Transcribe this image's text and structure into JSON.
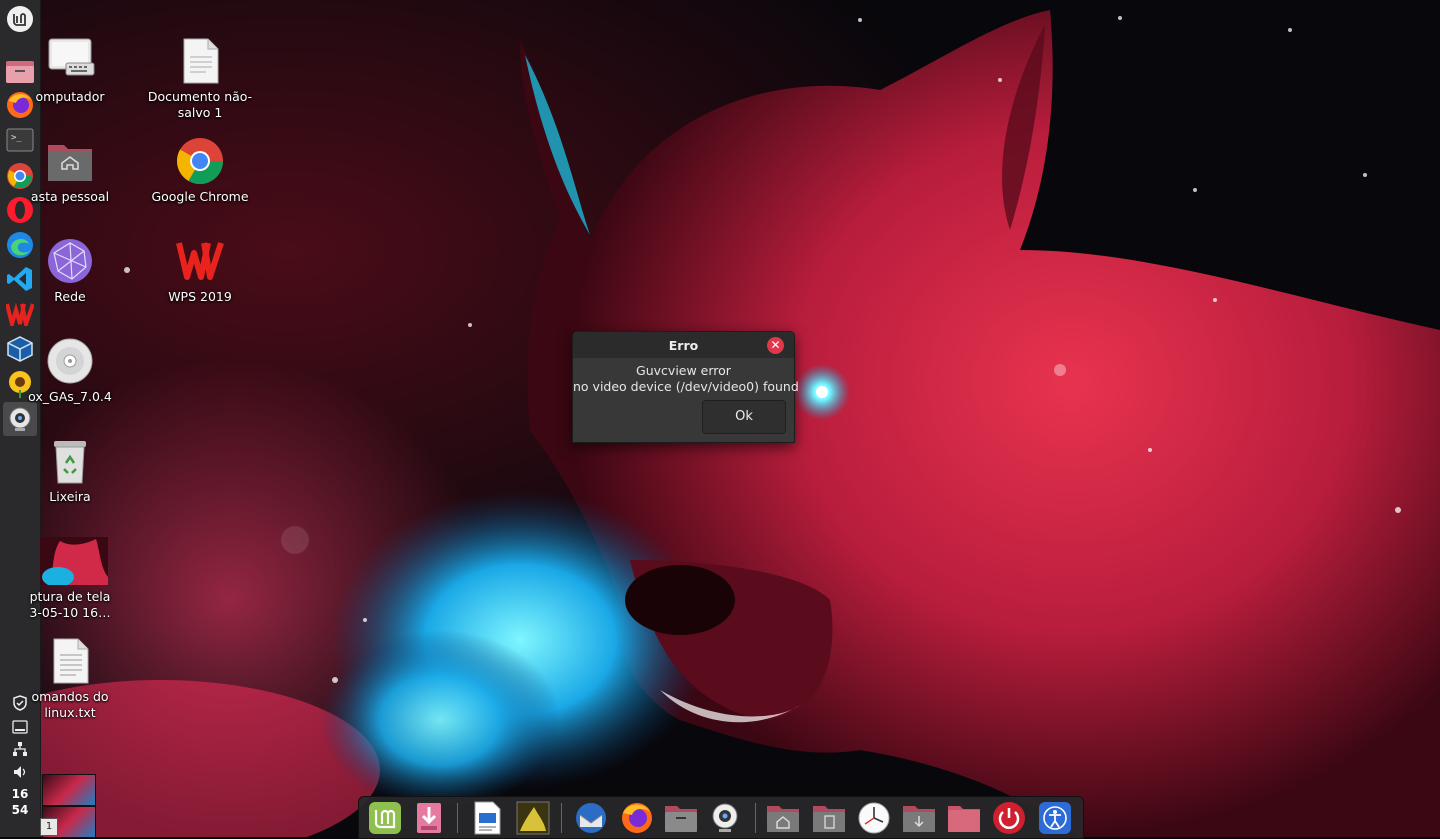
{
  "panel": {
    "launchers": [
      {
        "name": "menu-icon"
      },
      {
        "name": "files-icon"
      },
      {
        "name": "firefox-icon"
      },
      {
        "name": "terminal-icon"
      },
      {
        "name": "chrome-icon"
      },
      {
        "name": "opera-icon"
      },
      {
        "name": "edge-icon"
      },
      {
        "name": "vscode-icon"
      },
      {
        "name": "wps-icon"
      },
      {
        "name": "virtualbox-icon"
      },
      {
        "name": "sunflower-icon"
      },
      {
        "name": "webcam-icon"
      }
    ],
    "clock": {
      "hour": "16",
      "minute": "54"
    },
    "workspace_number": "1"
  },
  "desktop": {
    "icons": [
      {
        "id": "computer",
        "label": "omputador"
      },
      {
        "id": "document",
        "label": "Documento não-\nsalvo 1"
      },
      {
        "id": "home",
        "label": "asta pessoal"
      },
      {
        "id": "chrome",
        "label": "Google Chrome"
      },
      {
        "id": "network",
        "label": "Rede"
      },
      {
        "id": "wps",
        "label": "WPS 2019"
      },
      {
        "id": "disc",
        "label": "ox_GAs_7.0.4"
      },
      {
        "id": "trash",
        "label": "Lixeira"
      },
      {
        "id": "screenshot",
        "label": "ptura de tela\n3-05-10 16…"
      },
      {
        "id": "textfile",
        "label": "omandos do\nlinux.txt"
      }
    ]
  },
  "dialog": {
    "title": "Erro",
    "line1": "Guvcview error",
    "line2": "no video device (/dev/video0) found",
    "ok_label": "Ok"
  },
  "dock": {
    "items": [
      "mint-menu-icon",
      "download-archive-icon",
      "writer-document-icon",
      "image-viewer-icon",
      "thunderbird-icon",
      "firefox-icon",
      "files-icon",
      "webcam-icon",
      "home-folder-icon",
      "documents-folder-icon",
      "clock-icon",
      "downloads-folder-icon",
      "folder-icon",
      "power-icon",
      "accessibility-icon"
    ]
  },
  "colors": {
    "panel": "#2a2a2c",
    "dialog_bg": "#383838",
    "close_red": "#e0374a",
    "accent_green": "#8fbf4d"
  }
}
